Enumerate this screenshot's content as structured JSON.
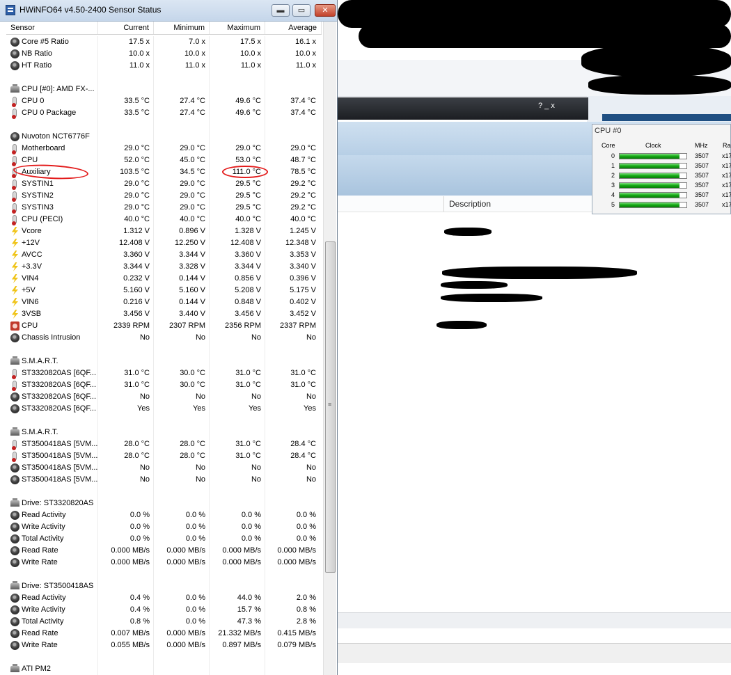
{
  "window": {
    "title": "HWiNFO64 v4.50-2400 Sensor Status",
    "min_glyph": "▬",
    "max_glyph": "▭",
    "close_glyph": "✕"
  },
  "columns": [
    "Sensor",
    "Current",
    "Minimum",
    "Maximum",
    "Average"
  ],
  "rows": [
    {
      "icon": "chip",
      "name": "Core #5 Ratio",
      "cur": "17.5 x",
      "min": "7.0 x",
      "max": "17.5 x",
      "avg": "16.1 x"
    },
    {
      "icon": "chip",
      "name": "NB Ratio",
      "cur": "10.0 x",
      "min": "10.0 x",
      "max": "10.0 x",
      "avg": "10.0 x"
    },
    {
      "icon": "chip",
      "name": "HT Ratio",
      "cur": "11.0 x",
      "min": "11.0 x",
      "max": "11.0 x",
      "avg": "11.0 x"
    },
    {
      "blank": true
    },
    {
      "icon": "hw",
      "name": "CPU [#0]: AMD FX-...",
      "header": true
    },
    {
      "icon": "temp",
      "name": "CPU 0",
      "cur": "33.5 °C",
      "min": "27.4 °C",
      "max": "49.6 °C",
      "avg": "37.4 °C"
    },
    {
      "icon": "temp",
      "name": "CPU 0 Package",
      "cur": "33.5 °C",
      "min": "27.4 °C",
      "max": "49.6 °C",
      "avg": "37.4 °C"
    },
    {
      "blank": true
    },
    {
      "icon": "chip",
      "name": "Nuvoton NCT6776F",
      "header": true
    },
    {
      "icon": "temp",
      "name": "Motherboard",
      "cur": "29.0 °C",
      "min": "29.0 °C",
      "max": "29.0 °C",
      "avg": "29.0 °C"
    },
    {
      "icon": "temp",
      "name": "CPU",
      "cur": "52.0 °C",
      "min": "45.0 °C",
      "max": "53.0 °C",
      "avg": "48.7 °C"
    },
    {
      "icon": "temp",
      "name": "Auxiliary",
      "cur": "103.5 °C",
      "min": "34.5 °C",
      "max": "111.0 °C",
      "avg": "78.5 °C"
    },
    {
      "icon": "temp",
      "name": "SYSTIN1",
      "cur": "29.0 °C",
      "min": "29.0 °C",
      "max": "29.5 °C",
      "avg": "29.2 °C"
    },
    {
      "icon": "temp",
      "name": "SYSTIN2",
      "cur": "29.0 °C",
      "min": "29.0 °C",
      "max": "29.5 °C",
      "avg": "29.2 °C"
    },
    {
      "icon": "temp",
      "name": "SYSTIN3",
      "cur": "29.0 °C",
      "min": "29.0 °C",
      "max": "29.5 °C",
      "avg": "29.2 °C"
    },
    {
      "icon": "temp",
      "name": "CPU (PECI)",
      "cur": "40.0 °C",
      "min": "40.0 °C",
      "max": "40.0 °C",
      "avg": "40.0 °C"
    },
    {
      "icon": "volt",
      "name": "Vcore",
      "cur": "1.312 V",
      "min": "0.896 V",
      "max": "1.328 V",
      "avg": "1.245 V"
    },
    {
      "icon": "volt",
      "name": "+12V",
      "cur": "12.408 V",
      "min": "12.250 V",
      "max": "12.408 V",
      "avg": "12.348 V"
    },
    {
      "icon": "volt",
      "name": "AVCC",
      "cur": "3.360 V",
      "min": "3.344 V",
      "max": "3.360 V",
      "avg": "3.353 V"
    },
    {
      "icon": "volt",
      "name": "+3.3V",
      "cur": "3.344 V",
      "min": "3.328 V",
      "max": "3.344 V",
      "avg": "3.340 V"
    },
    {
      "icon": "volt",
      "name": "VIN4",
      "cur": "0.232 V",
      "min": "0.144 V",
      "max": "0.856 V",
      "avg": "0.396 V"
    },
    {
      "icon": "volt",
      "name": "+5V",
      "cur": "5.160 V",
      "min": "5.160 V",
      "max": "5.208 V",
      "avg": "5.175 V"
    },
    {
      "icon": "volt",
      "name": "VIN6",
      "cur": "0.216 V",
      "min": "0.144 V",
      "max": "0.848 V",
      "avg": "0.402 V"
    },
    {
      "icon": "volt",
      "name": "3VSB",
      "cur": "3.456 V",
      "min": "3.440 V",
      "max": "3.456 V",
      "avg": "3.452 V"
    },
    {
      "icon": "fan",
      "name": "CPU",
      "cur": "2339 RPM",
      "min": "2307 RPM",
      "max": "2356 RPM",
      "avg": "2337 RPM"
    },
    {
      "icon": "chip",
      "name": "Chassis Intrusion",
      "cur": "No",
      "min": "No",
      "max": "No",
      "avg": "No"
    },
    {
      "blank": true
    },
    {
      "icon": "hw",
      "name": "S.M.A.R.T.",
      "header": true
    },
    {
      "icon": "temp",
      "name": "ST3320820AS [6QF...",
      "cur": "31.0 °C",
      "min": "30.0 °C",
      "max": "31.0 °C",
      "avg": "31.0 °C"
    },
    {
      "icon": "temp",
      "name": "ST3320820AS [6QF...",
      "cur": "31.0 °C",
      "min": "30.0 °C",
      "max": "31.0 °C",
      "avg": "31.0 °C"
    },
    {
      "icon": "chip",
      "name": "ST3320820AS [6QF...",
      "cur": "No",
      "min": "No",
      "max": "No",
      "avg": "No"
    },
    {
      "icon": "chip",
      "name": "ST3320820AS [6QF...",
      "cur": "Yes",
      "min": "Yes",
      "max": "Yes",
      "avg": "Yes"
    },
    {
      "blank": true
    },
    {
      "icon": "hw",
      "name": "S.M.A.R.T.",
      "header": true
    },
    {
      "icon": "temp",
      "name": "ST3500418AS [5VM...",
      "cur": "28.0 °C",
      "min": "28.0 °C",
      "max": "31.0 °C",
      "avg": "28.4 °C"
    },
    {
      "icon": "temp",
      "name": "ST3500418AS [5VM...",
      "cur": "28.0 °C",
      "min": "28.0 °C",
      "max": "31.0 °C",
      "avg": "28.4 °C"
    },
    {
      "icon": "chip",
      "name": "ST3500418AS [5VM...",
      "cur": "No",
      "min": "No",
      "max": "No",
      "avg": "No"
    },
    {
      "icon": "chip",
      "name": "ST3500418AS [5VM...",
      "cur": "No",
      "min": "No",
      "max": "No",
      "avg": "No"
    },
    {
      "blank": true
    },
    {
      "icon": "hw",
      "name": "Drive: ST3320820AS",
      "header": true
    },
    {
      "icon": "chip",
      "name": "Read Activity",
      "cur": "0.0 %",
      "min": "0.0 %",
      "max": "0.0 %",
      "avg": "0.0 %"
    },
    {
      "icon": "chip",
      "name": "Write Activity",
      "cur": "0.0 %",
      "min": "0.0 %",
      "max": "0.0 %",
      "avg": "0.0 %"
    },
    {
      "icon": "chip",
      "name": "Total Activity",
      "cur": "0.0 %",
      "min": "0.0 %",
      "max": "0.0 %",
      "avg": "0.0 %"
    },
    {
      "icon": "chip",
      "name": "Read Rate",
      "cur": "0.000 MB/s",
      "min": "0.000 MB/s",
      "max": "0.000 MB/s",
      "avg": "0.000 MB/s"
    },
    {
      "icon": "chip",
      "name": "Write Rate",
      "cur": "0.000 MB/s",
      "min": "0.000 MB/s",
      "max": "0.000 MB/s",
      "avg": "0.000 MB/s"
    },
    {
      "blank": true
    },
    {
      "icon": "hw",
      "name": "Drive: ST3500418AS",
      "header": true
    },
    {
      "icon": "chip",
      "name": "Read Activity",
      "cur": "0.4 %",
      "min": "0.0 %",
      "max": "44.0 %",
      "avg": "2.0 %"
    },
    {
      "icon": "chip",
      "name": "Write Activity",
      "cur": "0.4 %",
      "min": "0.0 %",
      "max": "15.7 %",
      "avg": "0.8 %"
    },
    {
      "icon": "chip",
      "name": "Total Activity",
      "cur": "0.8 %",
      "min": "0.0 %",
      "max": "47.3 %",
      "avg": "2.8 %"
    },
    {
      "icon": "chip",
      "name": "Read Rate",
      "cur": "0.007 MB/s",
      "min": "0.000 MB/s",
      "max": "21.332 MB/s",
      "avg": "0.415 MB/s"
    },
    {
      "icon": "chip",
      "name": "Write Rate",
      "cur": "0.055 MB/s",
      "min": "0.000 MB/s",
      "max": "0.897 MB/s",
      "avg": "0.079 MB/s"
    },
    {
      "blank": true
    },
    {
      "icon": "hw",
      "name": "ATI PM2",
      "header": true
    }
  ],
  "background_window": {
    "column_header": "Description",
    "dark_bar_buttons": "?   _   x"
  },
  "cpu_widget": {
    "title": "CPU #0",
    "headers": {
      "core": "Core",
      "clock": "Clock",
      "mhz": "MHz",
      "ratio": "Ra"
    },
    "cores": [
      {
        "index": "0",
        "mhz": "3507",
        "ratio": "x17",
        "load": 0.9
      },
      {
        "index": "1",
        "mhz": "3507",
        "ratio": "x17",
        "load": 0.9
      },
      {
        "index": "2",
        "mhz": "3507",
        "ratio": "x17",
        "load": 0.9
      },
      {
        "index": "3",
        "mhz": "3507",
        "ratio": "x17",
        "load": 0.9
      },
      {
        "index": "4",
        "mhz": "3507",
        "ratio": "x17",
        "load": 0.9
      },
      {
        "index": "5",
        "mhz": "3507",
        "ratio": "x17",
        "load": 0.9
      }
    ]
  },
  "colors": {
    "annotation_red": "#e31b1b",
    "bar_green": "#13a913",
    "title_bar": "#c5d6ea"
  }
}
